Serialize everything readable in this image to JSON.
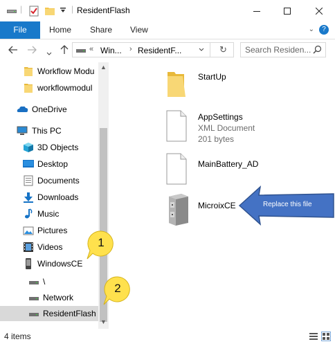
{
  "window": {
    "title": "ResidentFlash"
  },
  "ribbon": {
    "tabs": [
      "File",
      "Home",
      "Share",
      "View"
    ],
    "help_glyph": "?",
    "caret_glyph": "⌄"
  },
  "address": {
    "overflow": "«",
    "crumbs": [
      "Win...",
      "ResidentF..."
    ],
    "chevron_glyph": "›",
    "refresh_glyph": "↻"
  },
  "search": {
    "placeholder": "Search Residen..."
  },
  "sidebar": {
    "items": [
      {
        "label": "Workflow Modu",
        "icon": "folder-icon"
      },
      {
        "label": "workflowmodul",
        "icon": "folder-icon"
      },
      {
        "label": "OneDrive",
        "icon": "onedrive-cloud-icon"
      },
      {
        "label": "This PC",
        "icon": "computer-icon"
      },
      {
        "label": "3D Objects",
        "icon": "3d-objects-icon"
      },
      {
        "label": "Desktop",
        "icon": "desktop-icon"
      },
      {
        "label": "Documents",
        "icon": "documents-icon"
      },
      {
        "label": "Downloads",
        "icon": "downloads-icon"
      },
      {
        "label": "Music",
        "icon": "music-icon"
      },
      {
        "label": "Pictures",
        "icon": "pictures-icon"
      },
      {
        "label": "Videos",
        "icon": "videos-icon"
      },
      {
        "label": "WindowsCE",
        "icon": "device-icon"
      },
      {
        "label": "\\",
        "icon": "drive-icon"
      },
      {
        "label": "Network",
        "icon": "drive-icon"
      },
      {
        "label": "ResidentFlash",
        "icon": "drive-icon",
        "selected": true
      }
    ]
  },
  "files": [
    {
      "name": "StartUp",
      "type": "",
      "size": "",
      "icon": "folder-icon"
    },
    {
      "name": "AppSettings",
      "type": "XML Document",
      "size": "201 bytes",
      "icon": "xml-file-icon"
    },
    {
      "name": "MainBattery_AD",
      "type": "",
      "size": "",
      "icon": "blank-file-icon"
    },
    {
      "name": "MicroixCE",
      "type": "",
      "size": "",
      "icon": "filing-cabinet-icon"
    }
  ],
  "callout": {
    "text": "Replace this file"
  },
  "badges": {
    "first": "1",
    "second": "2"
  },
  "status": {
    "item_count": "4 items"
  },
  "colors": {
    "accent": "#1979ca",
    "callout": "#4472c4",
    "badge": "#ffe14d",
    "folder": "#f4c64e",
    "selection": "#d9d9d9"
  }
}
